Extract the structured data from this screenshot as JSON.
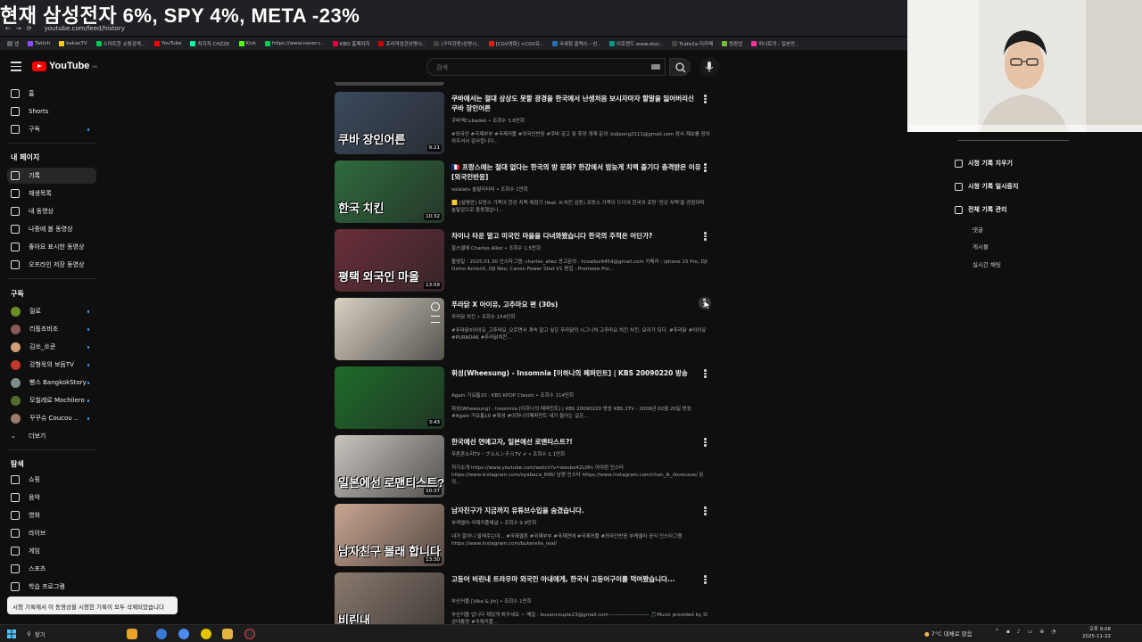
{
  "overlay_title": "현재 삼성전자 6%, SPY 4%, META -23%",
  "browser": {
    "url": "youtube.com/feed/history",
    "bookmarks": [
      "앱",
      "Twitch",
      "kakaoTV",
      "스마트한 쇼핑검색,..",
      "YouTube",
      "치지직 CHZZK",
      "Kick",
      "https://www.naver.c..",
      "KBO 홈페이지",
      "프리미엄관상명시..",
      "(구미강동)상명시..",
      "[CGV영화] <CGV유..",
      "국세청 홈택스 - 신..",
      "이토랜드 www.etoc..",
      "Tcafe2a 티카페",
      "원판업",
      "마나토끼 - 일본만.."
    ]
  },
  "youtube": {
    "logo_text": "YouTube",
    "logo_region": "KR",
    "search_placeholder": "검색"
  },
  "sidebar": {
    "main": [
      {
        "label": "홈",
        "icon": "home-icon"
      },
      {
        "label": "Shorts",
        "icon": "shorts-icon"
      },
      {
        "label": "구독",
        "icon": "subscriptions-icon"
      }
    ],
    "you_heading": "내 페이지",
    "you_items": [
      {
        "label": "기록",
        "icon": "history-icon",
        "active": true
      },
      {
        "label": "재생목록",
        "icon": "playlist-icon"
      },
      {
        "label": "내 동영상",
        "icon": "my-videos-icon"
      },
      {
        "label": "나중에 볼 동영상",
        "icon": "watch-later-icon"
      },
      {
        "label": "좋아요 표시한 동영상",
        "icon": "like-icon"
      },
      {
        "label": "오프라인 저장 동영상",
        "icon": "download-icon"
      }
    ],
    "subs_heading": "구독",
    "subs": [
      {
        "label": "릴로",
        "color": "#6b8e23"
      },
      {
        "label": "리틀조비조",
        "color": "#8b5a5a"
      },
      {
        "label": "김쏘_쏘쿤",
        "color": "#d4a07a"
      },
      {
        "label": "강형욱의 보듬TV",
        "color": "#c0392b"
      },
      {
        "label": "빵스 BangkokStory",
        "color": "#7f8c8d"
      },
      {
        "label": "모칠레로 Mochilero",
        "color": "#556b2f"
      },
      {
        "label": "꾸꾸슈 Coucou ..",
        "color": "#9b7a6a"
      }
    ],
    "more_label": "더보기",
    "explore_heading": "탐색",
    "explore": [
      {
        "label": "쇼핑",
        "icon": "shopping-icon"
      },
      {
        "label": "음악",
        "icon": "music-icon"
      },
      {
        "label": "영화",
        "icon": "movies-icon"
      },
      {
        "label": "라이브",
        "icon": "live-icon"
      },
      {
        "label": "게임",
        "icon": "gaming-icon"
      },
      {
        "label": "스포츠",
        "icon": "sports-icon"
      },
      {
        "label": "학습 프로그램",
        "icon": "learning-icon"
      }
    ]
  },
  "videos": [
    {
      "title": "쿠바에서는 절대 상상도 못할 광경을 한국에서 난생처음 보시자마자 할말을 잃어버리신 쿠바 장인어른",
      "channel": "쿠바맥Cubadek",
      "views": "조회수 3.6만회",
      "desc": "#외국인 #국제부부 #국제커플 #외국인반응 #쿠바 궁고 및 휴양 게재 문의 :kdjeong2111@gmail.com 장사 제보를 장이까주셔서 감사합니다...",
      "duration": "9:21",
      "caption": "쿠바 장인어른",
      "bg": "#3b4a5e",
      "verified": false
    },
    {
      "title": "🇫🇷 프랑스에는 절대 없다는 한국의 방 문화? 한강에서 밤늦게 치맥 즐기다 충격받은 이유 [외국인반응]",
      "channel": "solalatv 솔랄라티비",
      "views": "조회수 1만회",
      "desc": "🟨 [설명란] 프랑스 가족이 한강 치맥 체험기 (feat. K-치킨 감동) 프랑스 가족이 드디어 한국의 로망 '한강 치맥'을 경험하며 놀랄감으로 충동했습니...",
      "duration": "10:32",
      "caption": "한국 치킨",
      "bg": "#2e6b3d",
      "verified": false
    },
    {
      "title": "차이나 타운 말고 미국인 마을을 다녀와봤습니다 한국의 주적은 어딘가?",
      "channel": "찰스엘에 Charles Allez",
      "views": "조회수 1.5만회",
      "desc": "촬영일 : 2025.01.30 인스타그램: charles_allez 광고문의 : hcsallez9454@gmail.com 카메라 : iphone 15 Pro, DJI Ozmo Action5, DJI Neo, Canon Power Shot V1 편집 : Premiere Pro...",
      "duration": "13:59",
      "caption": "평택 외국인 마을",
      "bg": "#6a2e3a",
      "verified": false
    },
    {
      "title": "푸라닭 X 아이유, 고추마요 편 (30s)",
      "channel": "푸라닭 치킨",
      "views": "조회수 154만회",
      "desc": "#푸라닭X아이유_고추마요_오르면서 계속 말고 싶은 푸라닭의 시그니처 고추마요 치킨 치킨, 요리가 되다. #푸라닭 #아이유 #PURADAK #푸라닭치킨...",
      "duration": "",
      "caption": "",
      "bg": "#d8d0c2",
      "verified": false
    },
    {
      "title": "휘성(Wheesung) - Insomnia [이하나의 페퍼민트] | KBS 20090220 방송",
      "channel": "Again 가요톱10 : KBS KPOP Classic",
      "views": "조회수 114만회",
      "desc": "휘성(Wheesung) - Insomnia [이하나의 페퍼민트] | KBS 20090220 방송 KBS 2TV - 2009년 02월 20일 방송 #Again 가요톱10 #휘성 #이하나의페퍼민트 내가 들어는 길은...",
      "duration": "3:43",
      "caption": "",
      "bg": "#1e6b2a",
      "verified": false
    },
    {
      "title": "한국에선 연예고자, 일본에선 로맨티스트?!",
      "channel": "푸른혼소리TV・ブルルンそらTV",
      "views": "조회수 1.1만회",
      "desc": "저기소개 https://www.youtube.com/watch?v=wesbo42L0Pc 아야란 인스타 https://www.instagram.com/oyabaca_696/ 남편 인스타 https://www.instagram.com/chan_ik_ilovecave/ 문의...",
      "duration": "10:37",
      "caption": "일본에선 로맨티스트?!",
      "bg": "#c9c4be",
      "verified": true
    },
    {
      "title": "남자친구가 지금까지 유튜브수입을 숨겼습니다.",
      "channel": "부케엘라-국제커플채널",
      "views": "조회수 9.9만회",
      "desc": "내가 알아니 팔레주는데... #국제결혼 #국제부부 #국제연애 #국제커플 #외국인반응 부케엘라 공식 인스타그램 https://www.instagram.com/bukerella_real/",
      "duration": "13:30",
      "caption": "남자친구 몰래 합니다",
      "bg": "#c9a591",
      "verified": false
    },
    {
      "title": "고등어 비린내 트라우마 외국인 아내에게, 한국식 고등어구이를 먹여봤습니다...",
      "channel": "부산커플 [Vika & Jin]",
      "views": "조회수 1만회",
      "desc": "부산커플 입니다 재밌게 봐주세요 ~ 메일 : busancouple23@gmail.com ———————— 🎵Music provided by 브금대통령 #국제커플...",
      "duration": "",
      "caption": "비린내",
      "bg": "#8a7a6e",
      "verified": false
    }
  ],
  "right_panel": {
    "actions": [
      {
        "label": "시청 기록 지우기",
        "icon": "trash-icon"
      },
      {
        "label": "시청 기록 일시중지",
        "icon": "pause-icon"
      },
      {
        "label": "전체 기록 관리",
        "icon": "settings-icon"
      }
    ],
    "sub_items": [
      "댓글",
      "게시물",
      "실시간 채팅"
    ]
  },
  "toast": "시청 기록에서 이 동영상을 시청한 기록이 모두 삭제되었습니다",
  "taskbar": {
    "search_label": "찾기",
    "weather": "7°C 대체로 맑음",
    "time": "오후 9:08",
    "date": "2025-11-22"
  }
}
